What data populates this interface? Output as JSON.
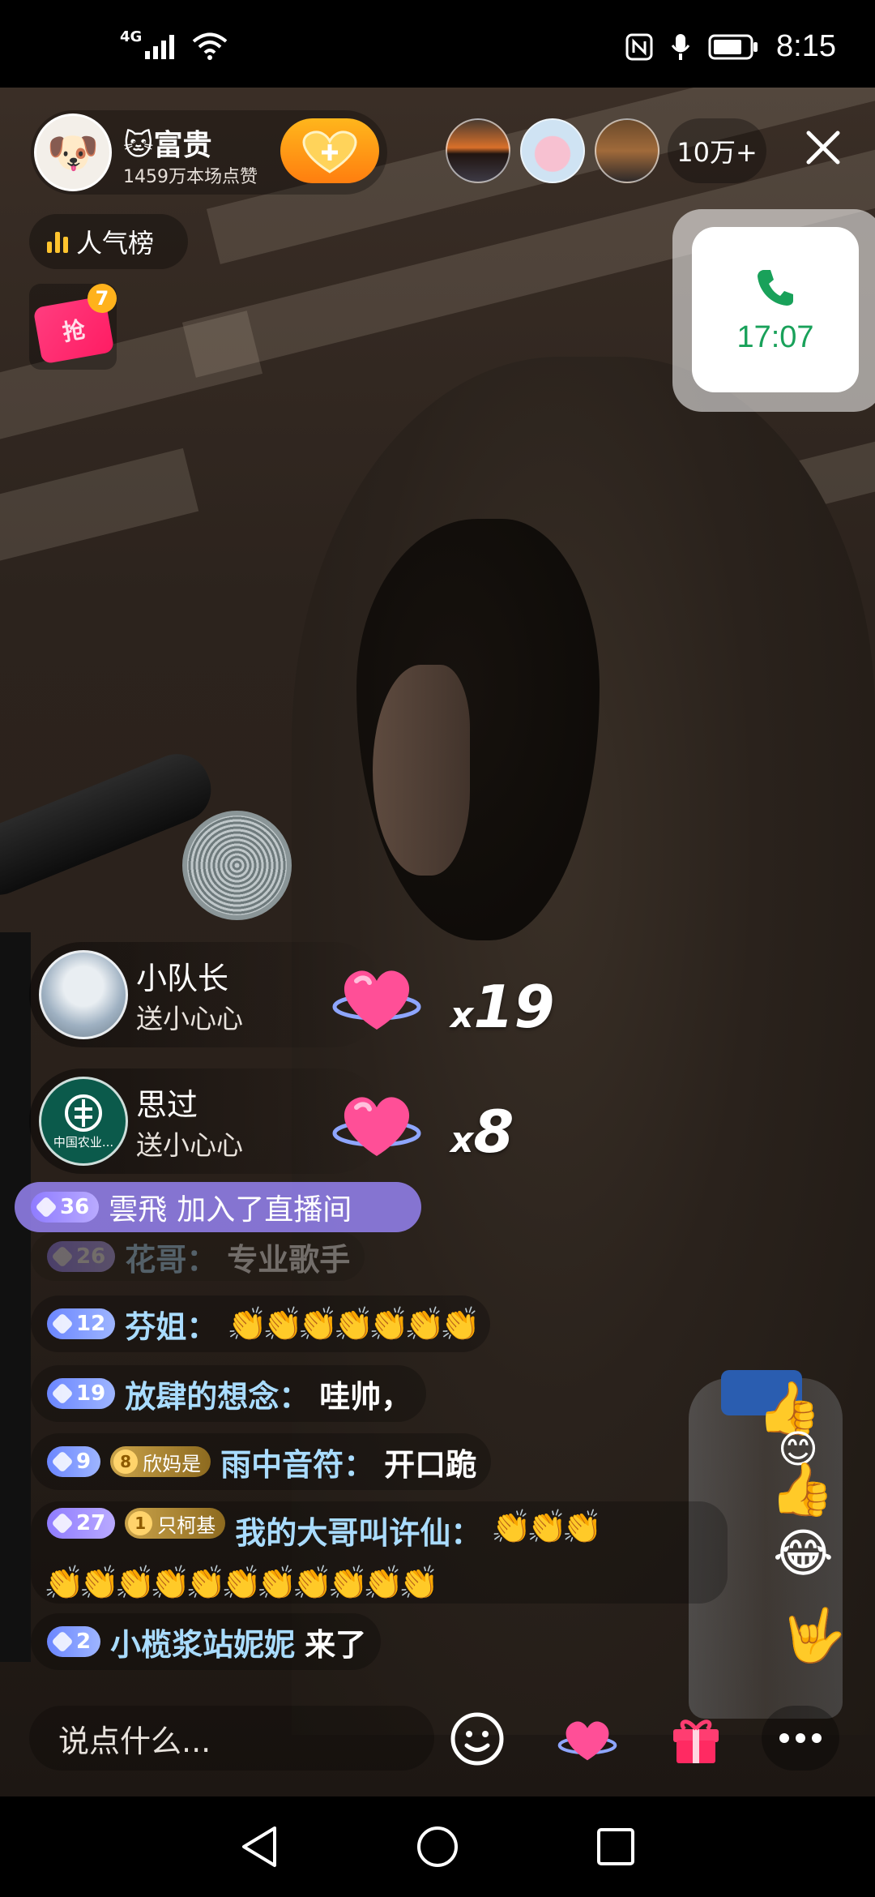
{
  "status_bar": {
    "network": "4G",
    "time": "8:15",
    "icons": [
      "signal-icon",
      "wifi-icon",
      "nfc-icon",
      "mic-icon",
      "battery-icon"
    ]
  },
  "anchor": {
    "name": "🐱富贵",
    "likes": "1459万本场点赞",
    "avatar_emoji": "🐶"
  },
  "viewers": {
    "count": "10万+"
  },
  "ranking": {
    "label": "人气榜"
  },
  "red_packet": {
    "icon_text": "抢",
    "badge": "7"
  },
  "call_widget": {
    "time": "17:07"
  },
  "gift_banners": [
    {
      "user": "小队长",
      "action": "送小心心",
      "count": "19",
      "count_prefix": "x"
    },
    {
      "user": "思过",
      "action": "送小心心",
      "count": "8",
      "count_prefix": "x",
      "avatar_text": "中国农业..."
    }
  ],
  "join_banner": {
    "level": "36",
    "user": "雲飛",
    "text": "加入了直播间"
  },
  "chat": [
    {
      "level": "26",
      "user": "花哥：",
      "message": "专业歌手"
    },
    {
      "level": "12",
      "user": "芬姐：",
      "message": "👏👏👏👏👏👏👏"
    },
    {
      "level": "19",
      "user": "放肆的想念：",
      "message": "哇帅，"
    },
    {
      "level": "9",
      "fan_level": "8",
      "fan_name": "欣妈是",
      "user": "雨中音符：",
      "message": "开口跪"
    },
    {
      "level": "27",
      "fan_level": "1",
      "fan_name": "只柯基",
      "user": "我的大哥叫许仙：",
      "message": "👏👏👏",
      "message2": "👏👏👏👏👏👏👏👏👏👏👏"
    },
    {
      "level": "2",
      "user": "小榄浆站妮妮",
      "message": "来了"
    }
  ],
  "input": {
    "placeholder": "说点什么..."
  },
  "floating_emoji": [
    "👍",
    "😊",
    "👍",
    "😂",
    "🤟"
  ],
  "colors": {
    "accent_orange": "#ff9a1a",
    "call_green": "#19a15a",
    "level_purple": "#8f7cff",
    "username_blue": "#a9dcff",
    "gift_pink": "#ff3d7f"
  }
}
